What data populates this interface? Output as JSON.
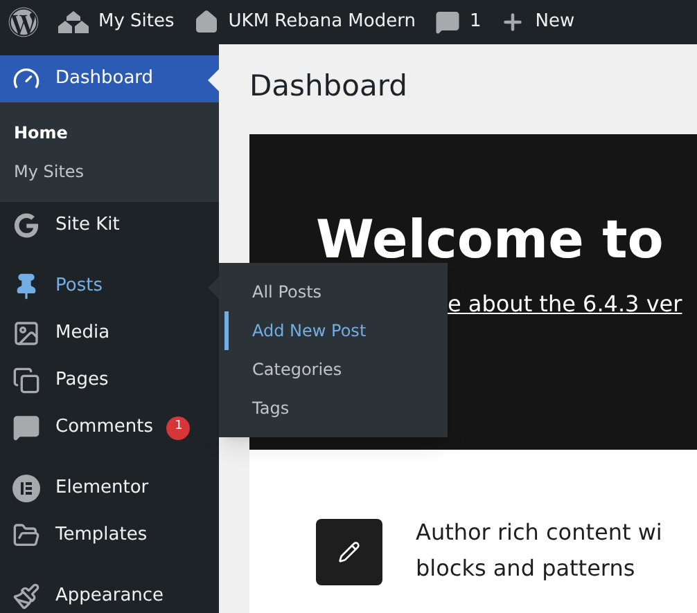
{
  "admin_bar": {
    "items": [
      {
        "kind": "logo"
      },
      {
        "kind": "sites",
        "label": "My Sites"
      },
      {
        "kind": "home",
        "label": "UKM Rebana Modern"
      },
      {
        "kind": "comments",
        "label": "1"
      },
      {
        "kind": "new",
        "label": "New"
      }
    ]
  },
  "sidebar": {
    "groups": [
      [
        {
          "kind": "dashboard",
          "label": "Dashboard",
          "selected": true,
          "open": false,
          "children": [
            {
              "label": "Home",
              "selected": true
            },
            {
              "label": "My Sites",
              "selected": false
            }
          ]
        },
        {
          "kind": "sitekit",
          "label": "Site Kit",
          "selected": false,
          "open": false
        }
      ],
      [
        {
          "kind": "posts",
          "label": "Posts",
          "selected": false,
          "open": true,
          "children": [
            {
              "label": "All Posts",
              "selected": false
            },
            {
              "label": "Add New Post",
              "selected": true
            },
            {
              "label": "Categories",
              "selected": false
            },
            {
              "label": "Tags",
              "selected": false
            }
          ]
        },
        {
          "kind": "media",
          "label": "Media",
          "selected": false,
          "open": false
        },
        {
          "kind": "pages",
          "label": "Pages",
          "selected": false,
          "open": false
        },
        {
          "kind": "comments",
          "label": "Comments",
          "selected": false,
          "open": false,
          "badge": "1"
        }
      ],
      [
        {
          "kind": "elementor",
          "label": "Elementor",
          "selected": false,
          "open": false
        },
        {
          "kind": "templates",
          "label": "Templates",
          "selected": false,
          "open": false
        }
      ],
      [
        {
          "kind": "appearance",
          "label": "Appearance",
          "selected": false,
          "open": false
        }
      ]
    ]
  },
  "main": {
    "title": "Dashboard",
    "welcome": {
      "heading": "Welcome to",
      "link": "e about the 6.4.3 ver"
    },
    "feature": {
      "lines": [
        "Author rich content wi",
        "blocks and patterns"
      ]
    }
  }
}
